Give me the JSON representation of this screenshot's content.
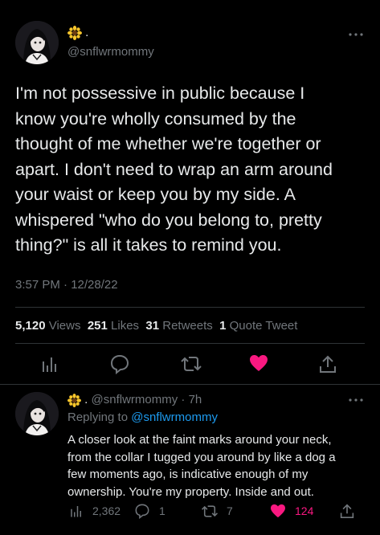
{
  "colors": {
    "background": "#000000",
    "text": "#e7e9ea",
    "muted": "#71767b",
    "link": "#1d9bf0",
    "like": "#f91880",
    "divider": "#2f3336"
  },
  "main_tweet": {
    "avatar_icon": "avatar-image",
    "display_name_emoji": "sunflower-icon",
    "display_name_suffix": ".",
    "handle": "@snflwrmommy",
    "more_icon": "more-icon",
    "text": "I'm not possessive in public because I\nknow you're wholly consumed by the\nthought of me whether we're together or\napart. I don't need to wrap an arm around\nyour waist or keep you by my side. A\nwhispered \"who do you belong to, pretty\nthing?\" is all it takes to remind you.",
    "timestamp": "3:57 PM · 12/28/22",
    "stats": {
      "views_count": "5,120",
      "views_label": "Views",
      "likes_count": "251",
      "likes_label": "Likes",
      "retweets_count": "31",
      "retweets_label": "Retweets",
      "quotes_count": "1",
      "quotes_label": "Quote Tweet"
    },
    "actions": [
      "analytics-icon",
      "reply-icon",
      "retweet-icon",
      "like-icon",
      "share-icon"
    ],
    "liked": true
  },
  "reply_tweet": {
    "avatar_icon": "avatar-image",
    "display_name_emoji": "sunflower-icon",
    "display_name_suffix": ".",
    "handle": "@snflwrmommy",
    "time": "· 7h",
    "replying_prefix": "Replying to",
    "replying_to": "@snflwrmommy",
    "text": "A closer look at the faint marks around your neck,\nfrom the collar I tugged you around by like a dog a\nfew moments ago, is indicative enough of my\nownership. You're my property. Inside and out.",
    "counts": {
      "views": "2,362",
      "replies": "1",
      "retweets": "7",
      "likes": "124"
    },
    "liked": true
  }
}
